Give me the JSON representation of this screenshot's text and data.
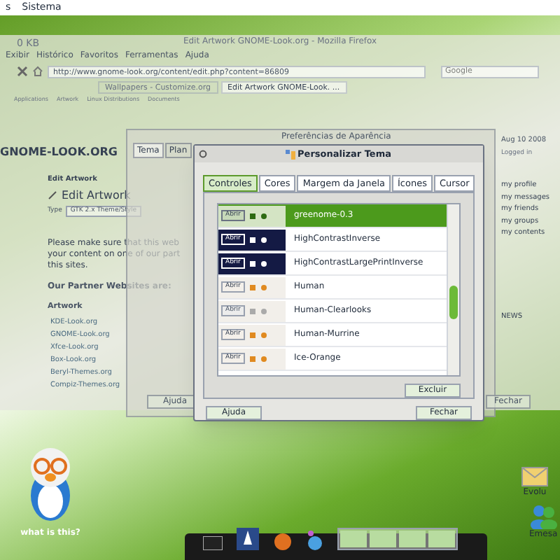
{
  "top_panel": {
    "items": [
      "s",
      "Sistema"
    ]
  },
  "browser": {
    "title": "Edit Artwork GNOME-Look.org - Mozilla Firefox",
    "download_size": "0 KB",
    "menu": [
      "Exibir",
      "Histórico",
      "Favoritos",
      "Ferramentas",
      "Ajuda"
    ],
    "url": "http://www.gnome-look.org/content/edit.php?content=86809",
    "search_placeholder": "Google",
    "tabs": [
      {
        "label": "Wallpapers - Customize.org",
        "selected": false
      },
      {
        "label": "Edit Artwork GNOME-Look. ...",
        "selected": true
      }
    ],
    "bookmarks": [
      "Applications",
      "Artwork",
      "Linux Distributions",
      "Documents"
    ],
    "page": {
      "logo": "GNOME-LOOK.ORG",
      "section_title": "Edit Artwork",
      "heading": "Edit Artwork",
      "type_label": "Type",
      "type_value": "GTK 2.x Theme/Style",
      "notice": "Please make sure that this web your content on one of our part this sites.",
      "partners_heading": "Our Partner Websites are:",
      "category": "Artwork",
      "links": [
        "KDE-Look.org",
        "GNOME-Look.org",
        "Xfce-Look.org",
        "Box-Look.org",
        "Beryl-Themes.org",
        "Compiz-Themes.org"
      ],
      "date": "Aug 10 2008",
      "login": "Logged in",
      "user_menu": [
        "my profile",
        "my messages",
        "my friends",
        "my groups",
        "my contents"
      ],
      "news": "NEWS"
    }
  },
  "appearance_window": {
    "title": "Preferências de Aparência",
    "tabs": [
      {
        "label": "Tema",
        "selected": true
      },
      {
        "label": "Plan",
        "selected": false
      }
    ],
    "buttons": [
      "Ajuda",
      "Fechar"
    ]
  },
  "dialog": {
    "title": "Personalizar Tema",
    "tabs": [
      {
        "label": "Controles",
        "selected": true
      },
      {
        "label": "Cores",
        "selected": false
      },
      {
        "label": "Margem da Janela",
        "selected": false
      },
      {
        "label": "Ícones",
        "selected": false
      },
      {
        "label": "Cursor",
        "selected": false
      }
    ],
    "themes": [
      {
        "name": "greenome-0.3",
        "preview_label": "Abrir",
        "kind": "green",
        "selected": true
      },
      {
        "name": "HighContrastInverse",
        "preview_label": "Abrir",
        "kind": "dark",
        "selected": false
      },
      {
        "name": "HighContrastLargePrintInverse",
        "preview_label": "Abrir",
        "kind": "dark",
        "selected": false
      },
      {
        "name": "Human",
        "preview_label": "Abrir",
        "kind": "light",
        "selected": false
      },
      {
        "name": "Human-Clearlooks",
        "preview_label": "Abrir",
        "kind": "grey",
        "selected": false
      },
      {
        "name": "Human-Murrine",
        "preview_label": "Abrir",
        "kind": "light",
        "selected": false
      },
      {
        "name": "Ice-Orange",
        "preview_label": "Abrir",
        "kind": "light",
        "selected": false
      }
    ],
    "delete_button": "Excluir",
    "help_button": "Ajuda",
    "close_button": "Fechar"
  },
  "desktop_icons": [
    {
      "label": "what is this?"
    },
    {
      "label": "Evolu"
    },
    {
      "label": "Emesa"
    }
  ]
}
